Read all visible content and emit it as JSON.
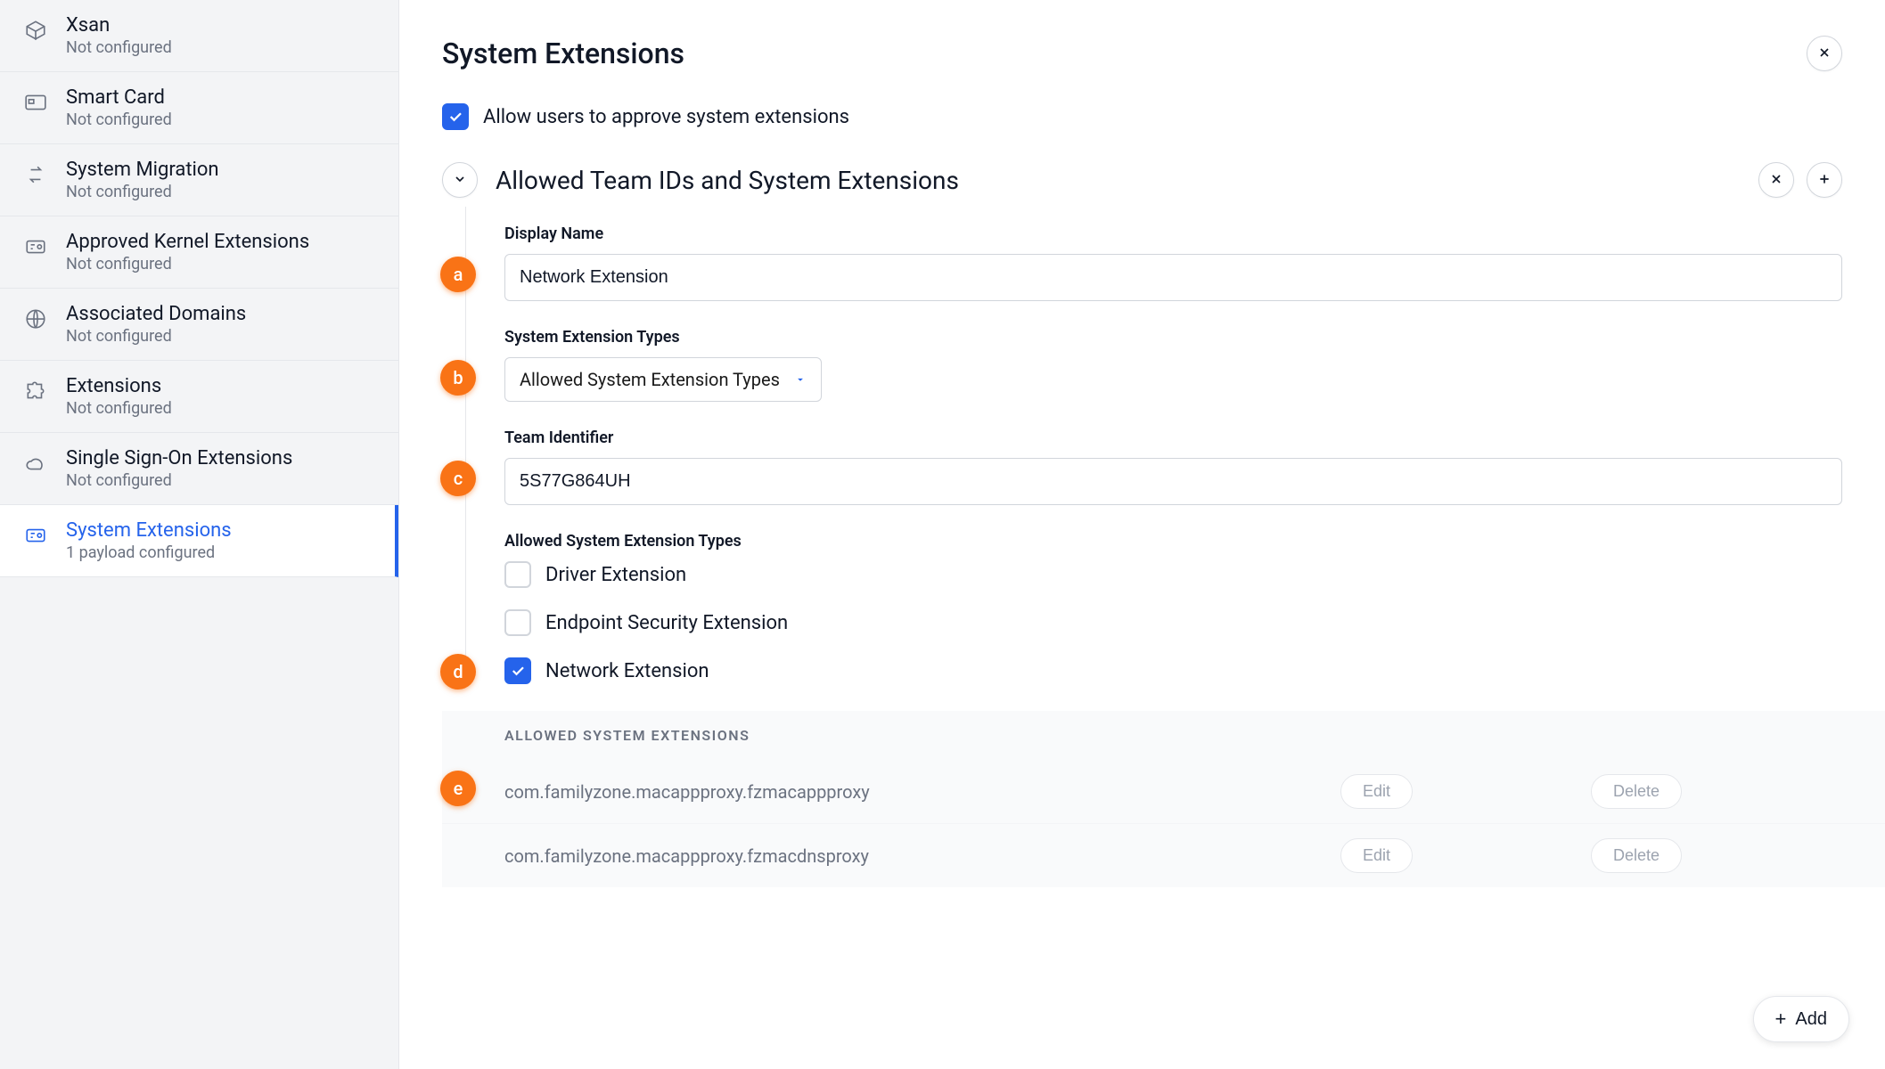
{
  "sidebar": {
    "items": [
      {
        "title": "Xsan",
        "subtitle": "Not configured",
        "icon": "box-icon",
        "active": false
      },
      {
        "title": "Smart Card",
        "subtitle": "Not configured",
        "icon": "card-icon",
        "active": false
      },
      {
        "title": "System Migration",
        "subtitle": "Not configured",
        "icon": "migrate-icon",
        "active": false
      },
      {
        "title": "Approved Kernel Extensions",
        "subtitle": "Not configured",
        "icon": "kernel-icon",
        "active": false
      },
      {
        "title": "Associated Domains",
        "subtitle": "Not configured",
        "icon": "globe-icon",
        "active": false
      },
      {
        "title": "Extensions",
        "subtitle": "Not configured",
        "icon": "puzzle-icon",
        "active": false
      },
      {
        "title": "Single Sign-On Extensions",
        "subtitle": "Not configured",
        "icon": "cloud-icon",
        "active": false
      },
      {
        "title": "System Extensions",
        "subtitle": "1 payload configured",
        "icon": "sysext-icon",
        "active": true
      }
    ]
  },
  "page": {
    "title": "System Extensions",
    "allow_checkbox_label": "Allow users to approve system extensions",
    "allow_checked": true,
    "section_title": "Allowed Team IDs and System Extensions",
    "fields": {
      "display_name": {
        "label": "Display Name",
        "value": "Network Extension",
        "badge": "a"
      },
      "ext_types": {
        "label": "System Extension Types",
        "value": "Allowed System Extension Types",
        "badge": "b"
      },
      "team_id": {
        "label": "Team Identifier",
        "value": "5S77G864UH",
        "badge": "c"
      },
      "allowed_types_label": "Allowed System Extension Types",
      "type_options": [
        {
          "label": "Driver Extension",
          "checked": false
        },
        {
          "label": "Endpoint Security Extension",
          "checked": false
        },
        {
          "label": "Network Extension",
          "checked": true,
          "badge": "d"
        }
      ]
    },
    "allowed_ext": {
      "header": "ALLOWED SYSTEM EXTENSIONS",
      "badge": "e",
      "rows": [
        {
          "id": "com.familyzone.macappproxy.fzmacappproxy",
          "edit": "Edit",
          "delete": "Delete"
        },
        {
          "id": "com.familyzone.macappproxy.fzmacdnsproxy",
          "edit": "Edit",
          "delete": "Delete"
        }
      ]
    },
    "add_button": "Add"
  }
}
